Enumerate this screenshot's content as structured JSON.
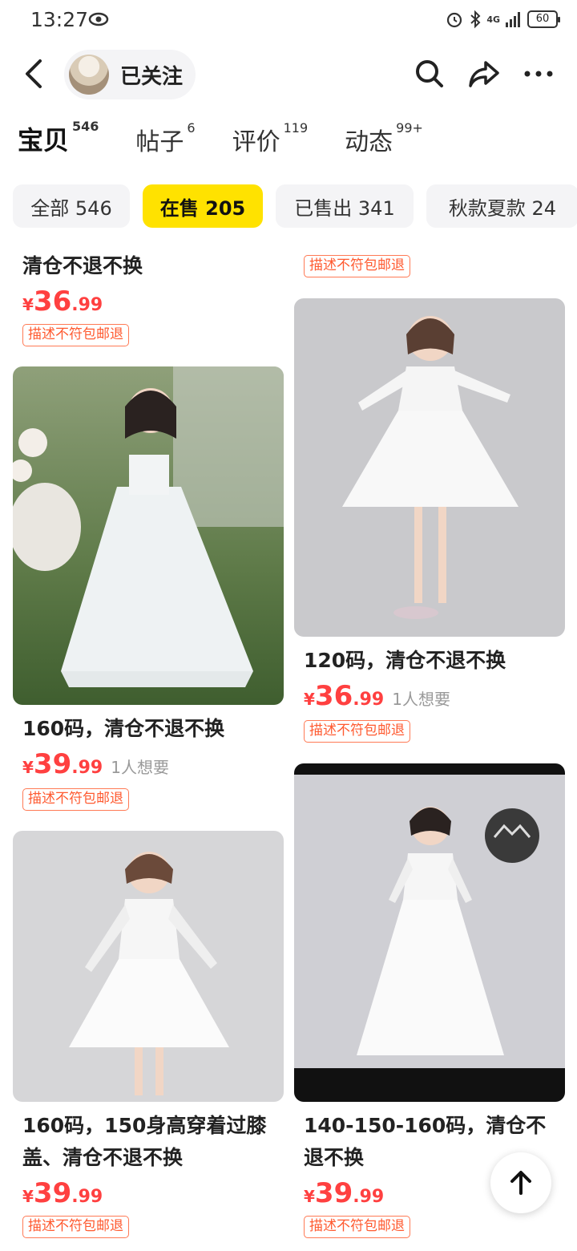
{
  "status_bar": {
    "time": "13:27",
    "network": "4G",
    "battery": "60"
  },
  "header": {
    "follow_label": "已关注",
    "icons": [
      "back-icon",
      "search-icon",
      "share-icon",
      "more-icon"
    ]
  },
  "tabs": [
    {
      "label": "宝贝",
      "count": "546",
      "active": true
    },
    {
      "label": "帖子",
      "count": "6",
      "active": false
    },
    {
      "label": "评价",
      "count": "119",
      "active": false
    },
    {
      "label": "动态",
      "count": "99+",
      "active": false
    }
  ],
  "filters": [
    {
      "label": "全部 546",
      "active": false
    },
    {
      "label": "在售 205",
      "active": true
    },
    {
      "label": "已售出 341",
      "active": false
    },
    {
      "label": "秋款夏款 24",
      "active": false
    }
  ],
  "products": [
    {
      "title": "清仓不退不换",
      "price_int": "36",
      "price_dec": ".99",
      "want": "",
      "tag": "描述不符包邮退"
    },
    {
      "title": "",
      "price_int": "",
      "price_dec": "",
      "want": "",
      "tag": "描述不符包邮退"
    },
    {
      "title": "160码，清仓不退不换",
      "price_int": "39",
      "price_dec": ".99",
      "want": "1人想要",
      "tag": "描述不符包邮退"
    },
    {
      "title": "120码，清仓不退不换",
      "price_int": "36",
      "price_dec": ".99",
      "want": "1人想要",
      "tag": "描述不符包邮退"
    },
    {
      "title": "160码，150身高穿着过膝盖、清仓不退不换",
      "price_int": "39",
      "price_dec": ".99",
      "want": "",
      "tag": "描述不符包邮退"
    },
    {
      "title": "140-150-160码，清仓不退不换",
      "price_int": "39",
      "price_dec": ".99",
      "want": "",
      "tag": "描述不符包邮退"
    }
  ],
  "currency": "¥",
  "colors": {
    "accent": "#ffe200",
    "price": "#ff4040",
    "tag": "#ff5a30"
  },
  "scroll_top_icon": "arrow-up-icon"
}
